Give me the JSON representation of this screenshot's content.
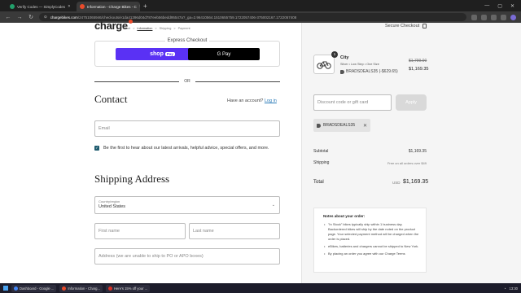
{
  "browser": {
    "tabs": [
      {
        "title": "Verify Codes — SimplyCodes",
        "active": false,
        "color": "#22a06b"
      },
      {
        "title": "Information - Charge Bikes - C",
        "active": true,
        "color": "#e94b2b"
      }
    ],
    "new_tab": "+",
    "url_host": "chargebikes.com",
    "url_path": "/24751065946/checkouts/e1da41396d04d787eeb56bedd95547a?_ga=2.96410564.1510655759.1722057406-375002167.1722057408"
  },
  "checkout": {
    "logo": "charge",
    "breadcrumbs": [
      "Cart",
      "Information",
      "Shipping",
      "Payment"
    ],
    "breadcrumb_sep": ">",
    "express_title": "Express Checkout",
    "shoppay_label": "shop",
    "shoppay_badge": "Pay",
    "gpay_label": "G Pay",
    "or_label": "OR",
    "contact_title": "Contact",
    "have_account": "Have an account?",
    "login_link": "Log in",
    "email_placeholder": "Email",
    "newsletter_label": "Be the first to hear about our latest arrivals, helpful advice, special offers, and more.",
    "newsletter_checked": true,
    "shipping_title": "Shipping Address",
    "country_label": "Country/region",
    "country_value": "United States",
    "first_name_placeholder": "First name",
    "last_name_placeholder": "Last name",
    "address_placeholder": "Address (we are unable to ship to PO or APO boxes)"
  },
  "summary": {
    "secure_checkout": "Secure Checkout",
    "product": {
      "qty": "1",
      "name": "City",
      "meta": "Silver • Low Step • One Size",
      "discount": "BRADSDEALS35 (-$629.65)",
      "price_original": "$1,799.00",
      "price_final": "$1,169.35"
    },
    "gift_placeholder": "Discount code or gift card",
    "apply_label": "Apply",
    "applied_code": "BRADSDEALS35",
    "subtotal_label": "Subtotal",
    "subtotal_value": "$1,169.35",
    "shipping_label": "Shipping",
    "shipping_value": "Free on all orders over $49",
    "total_label": "Total",
    "total_currency": "USD",
    "total_value": "$1,169.35",
    "notes_title": "Notes about your order:",
    "notes": [
      "\"In Stock\" bikes typically ship within 1 business day. Backordered bikes will ship by the date noted on the product page. Your selected payment method will be charged when the order is placed.",
      "eBikes, batteries and chargers cannot be shipped to New York.",
      "By placing an order you agree with our Charge Terms"
    ]
  },
  "taskbar": {
    "items": [
      {
        "label": "Dashboard - Google ...",
        "color": "#4285f4"
      },
      {
        "label": "Information - Charg...",
        "color": "#e94b2b"
      },
      {
        "label": "Here's 15% off your ...",
        "color": "#d93025"
      }
    ],
    "time": "13:30"
  }
}
